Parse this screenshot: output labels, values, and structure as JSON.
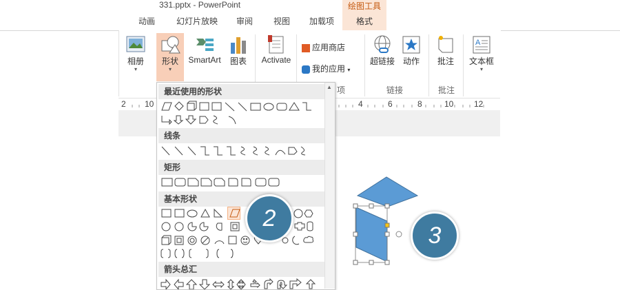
{
  "window": {
    "title": "331.pptx - PowerPoint",
    "context_tab": "绘图工具"
  },
  "tabs": [
    "动画",
    "幻灯片放映",
    "审阅",
    "视图",
    "加载项",
    "格式"
  ],
  "ribbon": {
    "album": "相册",
    "shapes": "形状",
    "smartart": "SmartArt",
    "chart": "图表",
    "activate": "Activate",
    "app_store": "应用商店",
    "my_apps": "我的应用",
    "hyperlink": "超链接",
    "action": "动作",
    "comment": "批注",
    "textbox": "文本框",
    "group_apps_partial": "项",
    "group_links": "链接",
    "group_comments": "批注"
  },
  "ruler": [
    "2",
    "10",
    "4",
    "6",
    "8",
    "10",
    "12"
  ],
  "shapes_panel": {
    "sections": [
      "最近使用的形状",
      "线条",
      "矩形",
      "基本形状",
      "箭头总汇"
    ]
  },
  "callouts": {
    "two": "2",
    "three": "3"
  },
  "colors": {
    "accent": "#c55a11",
    "context_tab_bg": "#fbe5d6",
    "shape_fill": "#5b9bd5",
    "callout_fill": "#3f7ba0"
  }
}
